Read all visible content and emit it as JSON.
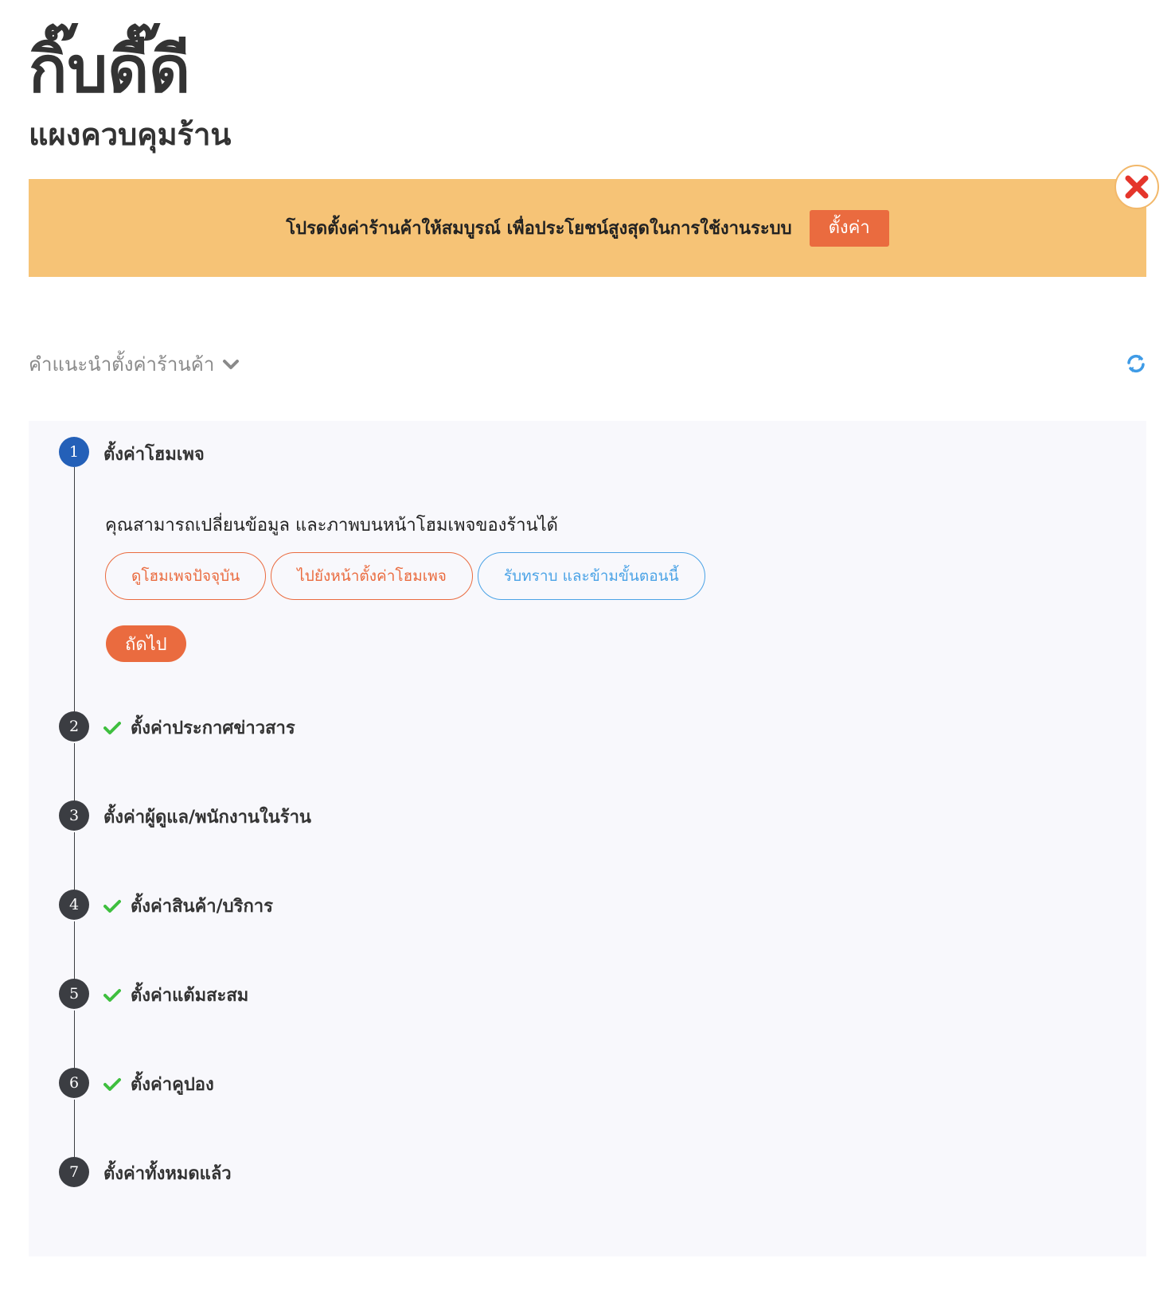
{
  "header": {
    "shop_name": "กิ๊บดี๊ดี",
    "subtitle": "แผงควบคุมร้าน"
  },
  "banner": {
    "message": "โปรดตั้งค่าร้านค้าให้สมบูรณ์ เพื่อประโยชน์สูงสุดในการใช้งานระบบ",
    "button_label": "ตั้งค่า",
    "close_icon": "close-x-icon",
    "background": "#f6c376",
    "accent": "#ea6b3f"
  },
  "guide": {
    "title": "คำแนะนำตั้งค่าร้านค้า",
    "toggle_icon": "chevron-down-icon",
    "refresh_icon": "refresh-icon"
  },
  "steps": [
    {
      "number": "1",
      "title": "ตั้งค่าโฮมเพจ",
      "completed": false,
      "active": true,
      "description": "คุณสามารถเปลี่ยนข้อมูล และภาพบนหน้าโฮมเพจของร้านได้",
      "actions": {
        "view_homepage": "ดูโฮมเพจปัจจุบัน",
        "go_homepage_settings": "ไปยังหน้าตั้งค่าโฮมเพจ",
        "acknowledge_skip": "รับทราบ และข้ามขั้นตอนนี้"
      },
      "next_label": "ถัดไป"
    },
    {
      "number": "2",
      "title": "ตั้งค่าประกาศข่าวสาร",
      "completed": true
    },
    {
      "number": "3",
      "title": "ตั้งค่าผู้ดูแล/พนักงานในร้าน",
      "completed": false
    },
    {
      "number": "4",
      "title": "ตั้งค่าสินค้า/บริการ",
      "completed": true
    },
    {
      "number": "5",
      "title": "ตั้งค่าแต้มสะสม",
      "completed": true
    },
    {
      "number": "6",
      "title": "ตั้งค่าคูปอง",
      "completed": true
    },
    {
      "number": "7",
      "title": "ตั้งค่าทั้งหมดแล้ว",
      "completed": false
    }
  ],
  "colors": {
    "active_step": "#2460b8",
    "step": "#3b3d42",
    "check": "#3fbf3f",
    "link_blue": "#4ba3e6",
    "panel_bg": "#f8f8fc"
  }
}
